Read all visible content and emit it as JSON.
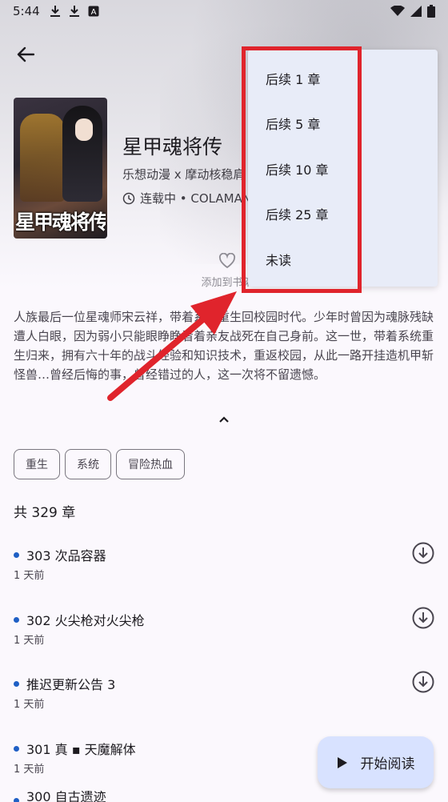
{
  "status_bar": {
    "time": "5:44"
  },
  "book": {
    "title": "星甲魂将传",
    "author": "乐想动漫 x 摩动核稳肩",
    "status": "连载中 • COLAMAN",
    "cover_text": "星甲魂将传",
    "favorite_label": "添加到书架",
    "description": "人族最后一位星魂师宋云祥，带着系统重生回校园时代。少年时曾因为魂脉残缺遭人白眼，因为弱小只能眼睁睁看着亲友战死在自己身前。这一世，带着系统重生归来，拥有六十年的战斗经验和知识技术，重返校园，从此一路开挂造机甲斩怪兽…曾经后悔的事，曾经错过的人，这一次将不留遗憾。"
  },
  "tags": [
    "重生",
    "系统",
    "冒险热血"
  ],
  "chapter_count": "共 329 章",
  "chapters": [
    {
      "title": "303 次品容器",
      "time": "1 天前"
    },
    {
      "title": "302 火尖枪对火尖枪",
      "time": "1 天前"
    },
    {
      "title": "推迟更新公告 3",
      "time": "1 天前"
    },
    {
      "title": "301 真 ▪ 天魔解体",
      "time": "1 天前"
    },
    {
      "title": "300 自古遗迹",
      "time": ""
    }
  ],
  "fab": {
    "label": "开始阅读"
  },
  "dropdown_menu": {
    "items": [
      "后续 1 章",
      "后续 5 章",
      "后续 10 章",
      "后续 25 章",
      "未读"
    ]
  },
  "colors": {
    "highlight": "#e0242c",
    "unread_dot": "#1f5fc5",
    "fab_bg": "#d8e2ff",
    "menu_bg": "#e8ecf8"
  }
}
